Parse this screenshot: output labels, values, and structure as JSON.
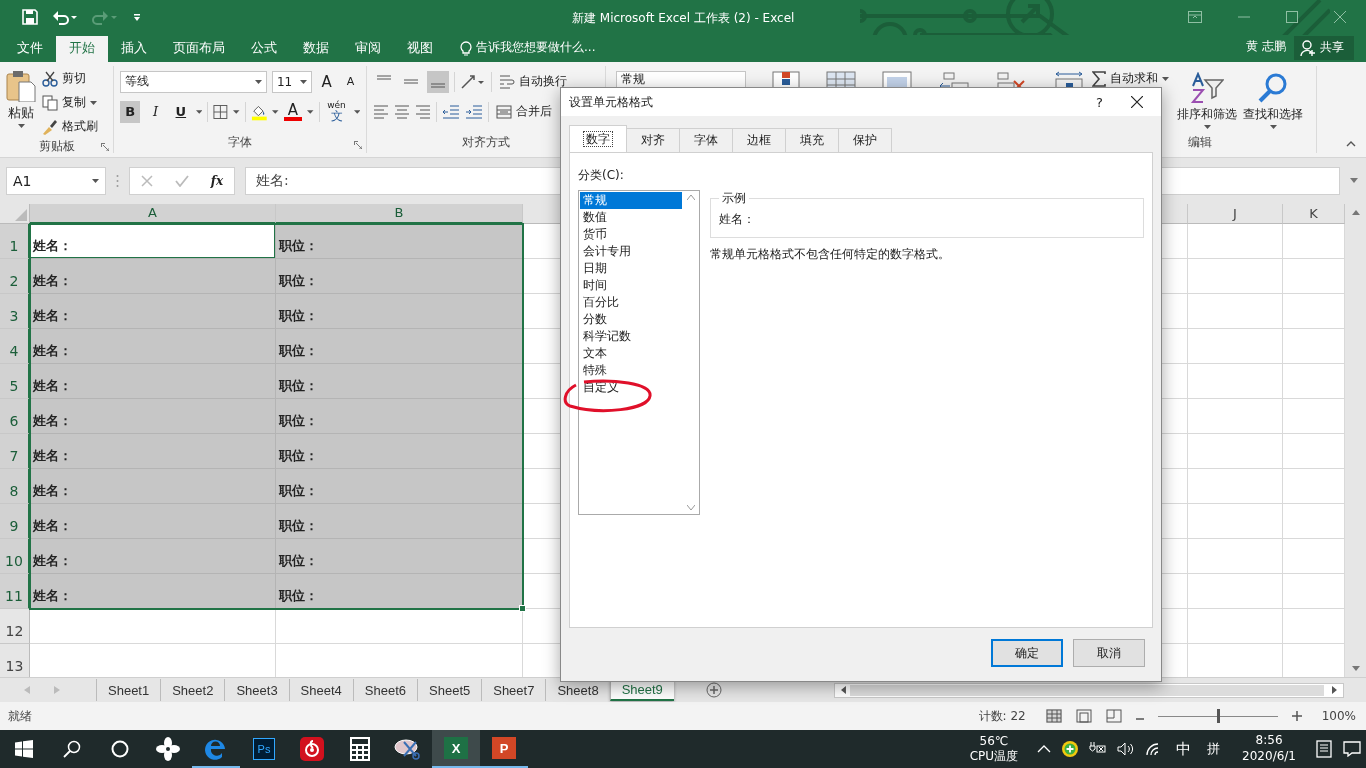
{
  "title_bar": {
    "title": "新建 Microsoft Excel 工作表 (2) - Excel"
  },
  "menu": {
    "tabs": [
      {
        "label": "文件",
        "selected": false
      },
      {
        "label": "开始",
        "selected": true
      },
      {
        "label": "插入",
        "selected": false
      },
      {
        "label": "页面布局",
        "selected": false
      },
      {
        "label": "公式",
        "selected": false
      },
      {
        "label": "数据",
        "selected": false
      },
      {
        "label": "审阅",
        "selected": false
      },
      {
        "label": "视图",
        "selected": false
      }
    ],
    "tell_me": "告诉我您想要做什么...",
    "user": "黄 志鹏",
    "share": "共享"
  },
  "ribbon": {
    "clipboard": {
      "paste": "粘贴",
      "cut": "剪切",
      "copy": "复制",
      "format_painter": "格式刷",
      "label": "剪贴板"
    },
    "font": {
      "name": "等线",
      "size": "11",
      "grow": "A",
      "shrink": "A",
      "styles": [
        {
          "label": "B",
          "pressed": true
        },
        {
          "label": "I",
          "pressed": false
        },
        {
          "label": "U",
          "pressed": false
        }
      ],
      "font_color": "A",
      "phonetic": "wén",
      "phonetic_char": "文",
      "label": "字体"
    },
    "alignment": {
      "vertical": [
        {
          "selected": false
        },
        {
          "selected": false
        },
        {
          "selected": true
        }
      ],
      "wrap": "自动换行",
      "merge": "合并后",
      "label": "对齐方式"
    },
    "number_format": "常规",
    "editing": {
      "autosum": "自动求和",
      "sort": "排序和筛选",
      "find": "查找和选择",
      "label": "编辑"
    }
  },
  "formula_bar": {
    "name_box": "A1",
    "function_label": "fx",
    "formula": "姓名:"
  },
  "columns": [
    {
      "label": "A",
      "selected": true
    },
    {
      "label": "B",
      "selected": true
    },
    {
      "label": "J",
      "selected": false
    },
    {
      "label": "K",
      "selected": false
    }
  ],
  "rows": [
    {
      "label": "1",
      "selected": true,
      "cells": [
        {
          "text": "姓名：",
          "selected": true,
          "active": true
        },
        {
          "text": "职位：",
          "selected": true,
          "active": false
        }
      ]
    },
    {
      "label": "2",
      "selected": true,
      "cells": [
        {
          "text": "姓名：",
          "selected": true,
          "active": false
        },
        {
          "text": "职位：",
          "selected": true,
          "active": false
        }
      ]
    },
    {
      "label": "3",
      "selected": true,
      "cells": [
        {
          "text": "姓名：",
          "selected": true,
          "active": false
        },
        {
          "text": "职位：",
          "selected": true,
          "active": false
        }
      ]
    },
    {
      "label": "4",
      "selected": true,
      "cells": [
        {
          "text": "姓名：",
          "selected": true,
          "active": false
        },
        {
          "text": "职位：",
          "selected": true,
          "active": false
        }
      ]
    },
    {
      "label": "5",
      "selected": true,
      "cells": [
        {
          "text": "姓名：",
          "selected": true,
          "active": false
        },
        {
          "text": "职位：",
          "selected": true,
          "active": false
        }
      ]
    },
    {
      "label": "6",
      "selected": true,
      "cells": [
        {
          "text": "姓名：",
          "selected": true,
          "active": false
        },
        {
          "text": "职位：",
          "selected": true,
          "active": false
        }
      ]
    },
    {
      "label": "7",
      "selected": true,
      "cells": [
        {
          "text": "姓名：",
          "selected": true,
          "active": false
        },
        {
          "text": "职位：",
          "selected": true,
          "active": false
        }
      ]
    },
    {
      "label": "8",
      "selected": true,
      "cells": [
        {
          "text": "姓名：",
          "selected": true,
          "active": false
        },
        {
          "text": "职位：",
          "selected": true,
          "active": false
        }
      ]
    },
    {
      "label": "9",
      "selected": true,
      "cells": [
        {
          "text": "姓名：",
          "selected": true,
          "active": false
        },
        {
          "text": "职位：",
          "selected": true,
          "active": false
        }
      ]
    },
    {
      "label": "10",
      "selected": true,
      "cells": [
        {
          "text": "姓名：",
          "selected": true,
          "active": false
        },
        {
          "text": "职位：",
          "selected": true,
          "active": false
        }
      ]
    },
    {
      "label": "11",
      "selected": true,
      "cells": [
        {
          "text": "姓名：",
          "selected": true,
          "active": false
        },
        {
          "text": "职位：",
          "selected": true,
          "active": false
        }
      ]
    },
    {
      "label": "12",
      "selected": false,
      "cells": [
        {
          "selected": false,
          "active": false
        },
        {
          "selected": false,
          "active": false
        }
      ]
    },
    {
      "label": "13",
      "selected": false,
      "cells": [
        {
          "selected": false,
          "active": false
        },
        {
          "selected": false,
          "active": false
        }
      ]
    }
  ],
  "sheet_tabs": [
    {
      "label": "Sheet1",
      "selected": false
    },
    {
      "label": "Sheet2",
      "selected": false
    },
    {
      "label": "Sheet3",
      "selected": false
    },
    {
      "label": "Sheet4",
      "selected": false
    },
    {
      "label": "Sheet6",
      "selected": false
    },
    {
      "label": "Sheet5",
      "selected": false
    },
    {
      "label": "Sheet7",
      "selected": false
    },
    {
      "label": "Sheet8",
      "selected": false
    },
    {
      "label": "Sheet9",
      "selected": true
    }
  ],
  "status_bar": {
    "ready": "就绪",
    "count": "计数: 22",
    "zoom": {
      "level": 0.5,
      "reading": "100%"
    }
  },
  "dialog": {
    "title": "设置单元格格式",
    "help": "?",
    "tabs": [
      {
        "label": "数字",
        "selected": true
      },
      {
        "label": "对齐",
        "selected": false
      },
      {
        "label": "字体",
        "selected": false
      },
      {
        "label": "边框",
        "selected": false
      },
      {
        "label": "填充",
        "selected": false
      },
      {
        "label": "保护",
        "selected": false
      }
    ],
    "category_label": "分类(C):",
    "categories": [
      {
        "label": "常规",
        "selected": true
      },
      {
        "label": "数值",
        "selected": false
      },
      {
        "label": "货币",
        "selected": false
      },
      {
        "label": "会计专用",
        "selected": false
      },
      {
        "label": "日期",
        "selected": false
      },
      {
        "label": "时间",
        "selected": false
      },
      {
        "label": "百分比",
        "selected": false
      },
      {
        "label": "分数",
        "selected": false
      },
      {
        "label": "科学记数",
        "selected": false
      },
      {
        "label": "文本",
        "selected": false
      },
      {
        "label": "特殊",
        "selected": false
      },
      {
        "label": "自定义",
        "selected": false
      }
    ],
    "sample_legend": "示例",
    "sample": "姓名：",
    "description": "常规单元格格式不包含任何特定的数字格式。",
    "ok": "确定",
    "cancel": "取消"
  },
  "taskbar": {
    "apps": [
      {
        "kind": "pinwheel",
        "running": false,
        "active": false
      },
      {
        "kind": "edge",
        "running": true,
        "active": false
      },
      {
        "kind": "photoshop",
        "label": "Ps",
        "running": false,
        "active": false
      },
      {
        "kind": "music",
        "running": false,
        "active": false
      },
      {
        "kind": "calculator",
        "running": false,
        "active": false
      },
      {
        "kind": "snip",
        "running": false,
        "active": false
      },
      {
        "kind": "excel",
        "label": "X",
        "running": true,
        "active": true
      },
      {
        "kind": "powerpoint",
        "label": "P",
        "running": true,
        "active": false
      }
    ],
    "temperature": "56℃",
    "temperature_label": "CPU温度",
    "ime": "中",
    "ime_mode": "拼",
    "time": "8:56",
    "date": "2020/6/1"
  }
}
